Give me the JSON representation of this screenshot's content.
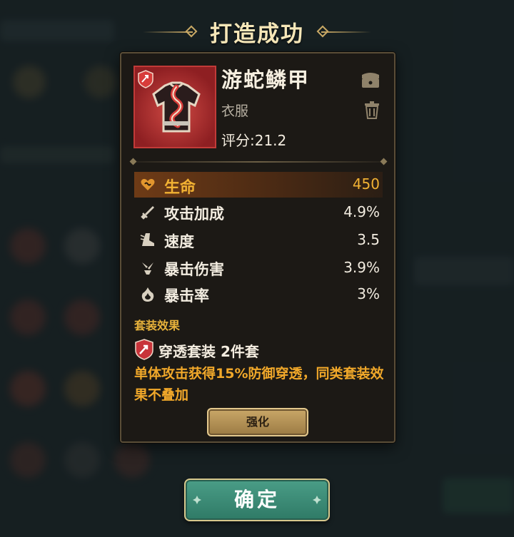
{
  "dialog": {
    "title": "打造成功"
  },
  "item": {
    "name": "游蛇鳞甲",
    "type": "衣服",
    "score": "评分:21.2",
    "rarity_color": "#c23a38"
  },
  "stats": {
    "main": {
      "label": "生命",
      "value": "450",
      "icon": "heart-icon"
    },
    "sub": [
      {
        "label": "攻击加成",
        "value": "4.9%",
        "icon": "sword-icon"
      },
      {
        "label": "速度",
        "value": "3.5",
        "icon": "boot-icon"
      },
      {
        "label": "暴击伤害",
        "value": "3.9%",
        "icon": "crit-damage-icon"
      },
      {
        "label": "暴击率",
        "value": "3%",
        "icon": "flame-icon"
      }
    ]
  },
  "set_effect": {
    "header": "套装效果",
    "name": "穿透套装 2件套",
    "description": "单体攻击获得15%防御穿透，同类套装效果不叠加"
  },
  "buttons": {
    "enhance": "强化",
    "confirm": "确定"
  },
  "colors": {
    "accent_gold": "#f2b233",
    "set_text": "#f1a82a",
    "confirm_green": "#3f8f79"
  }
}
